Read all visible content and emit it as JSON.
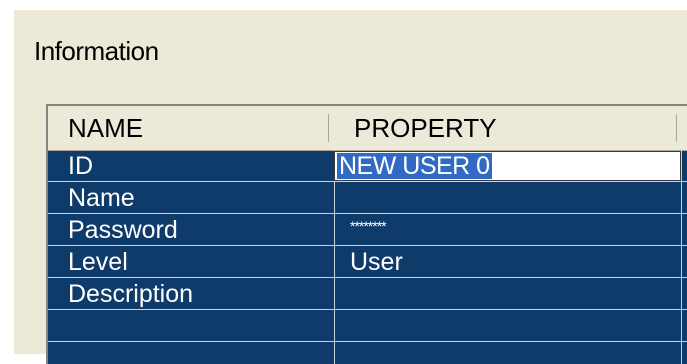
{
  "group": {
    "title": "Information"
  },
  "grid": {
    "columns": [
      "NAME",
      "PROPERTY"
    ],
    "rows": [
      {
        "name": "ID",
        "value": "NEW USER 0",
        "editing": true
      },
      {
        "name": "Name",
        "value": ""
      },
      {
        "name": "Password",
        "value": "********"
      },
      {
        "name": "Level",
        "value": "User"
      },
      {
        "name": "Description",
        "value": ""
      },
      {
        "name": "",
        "value": ""
      }
    ]
  },
  "colors": {
    "grid_background": "#0f3b6b",
    "header_background": "#ece9d8",
    "selection": "#316ac5",
    "panel_background": "#ece9d8"
  }
}
